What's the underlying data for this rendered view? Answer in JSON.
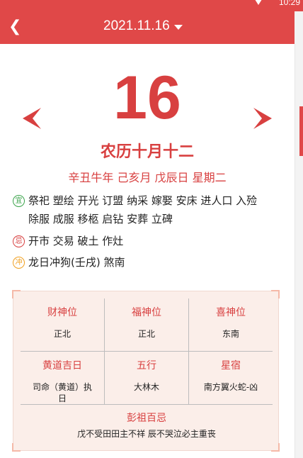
{
  "status_bar": {
    "time": "10:29"
  },
  "header": {
    "date": "2021.11.16"
  },
  "day_number": "16",
  "lunar_date": "农历十月十二",
  "ganzhi": "辛丑牛年 己亥月 戊辰日 星期二",
  "yi": {
    "badge": "宜",
    "text": "祭祀 塑绘 开光 订盟 纳采 嫁娶 安床 进人口 入殓 除服 成服 移柩 启钻 安葬 立碑"
  },
  "ji": {
    "badge": "忌",
    "text": "开市 交易 破土 作灶"
  },
  "chong": {
    "badge": "冲",
    "text": "龙日冲狗(壬戌) 煞南"
  },
  "card": {
    "row1": [
      {
        "title": "财神位",
        "value": "正北"
      },
      {
        "title": "福神位",
        "value": "正北"
      },
      {
        "title": "喜神位",
        "value": "东南"
      }
    ],
    "row2": [
      {
        "title": "黄道吉日",
        "value": "司命（黄道）执日"
      },
      {
        "title": "五行",
        "value": "大林木"
      },
      {
        "title": "星宿",
        "value": "南方翼火蛇-凶"
      }
    ],
    "pengzu": {
      "title": "彭祖百忌",
      "value": "戊不受田田主不祥 辰不哭泣必主重丧"
    }
  },
  "colors": {
    "accent": "#e04848",
    "text_red": "#d84040",
    "card_bg": "#fbeee9"
  }
}
